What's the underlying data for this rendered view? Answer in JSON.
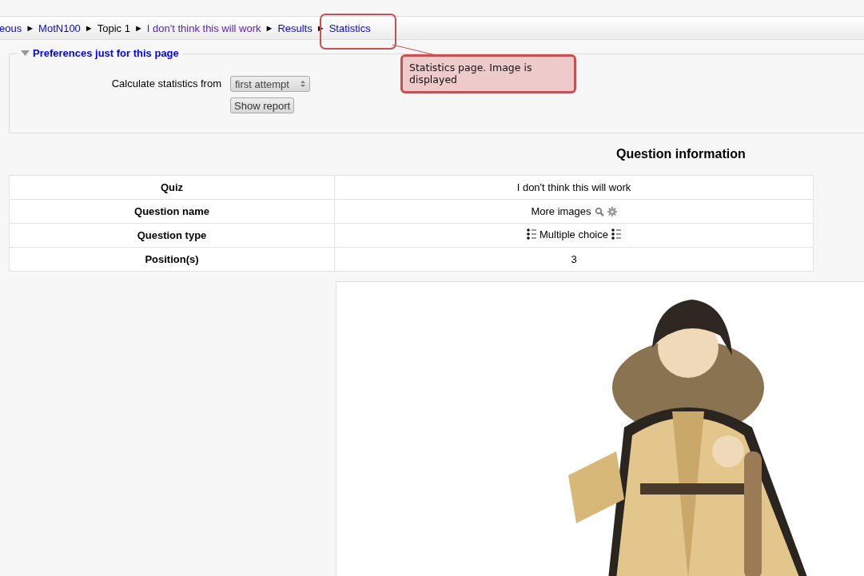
{
  "breadcrumb": [
    {
      "kind": "link",
      "text": "eous"
    },
    {
      "kind": "separator",
      "text": "►"
    },
    {
      "kind": "link",
      "text": "MotN100"
    },
    {
      "kind": "separator",
      "text": "►"
    },
    {
      "kind": "text",
      "text": "Topic 1"
    },
    {
      "kind": "separator",
      "text": "►"
    },
    {
      "kind": "visited",
      "text": "I don't think this will work"
    },
    {
      "kind": "separator",
      "text": "►"
    },
    {
      "kind": "link",
      "text": "Results"
    },
    {
      "kind": "separator",
      "text": "►"
    },
    {
      "kind": "link",
      "text": "Statistics"
    }
  ],
  "preferences": {
    "legend": "Preferences just for this page",
    "expanded": true,
    "field_label": "Calculate statistics from",
    "select_value": "first attempt",
    "button": "Show report"
  },
  "heading": "Question information",
  "table": {
    "rows": [
      {
        "kind": "plain",
        "label": "Quiz",
        "value": "I don't think this will work"
      },
      {
        "kind": "name",
        "label": "Question name",
        "value": "More images"
      },
      {
        "kind": "type",
        "label": "Question type",
        "value": "Multiple choice"
      },
      {
        "kind": "plain",
        "label": "Position(s)",
        "value": "3"
      }
    ]
  },
  "annotation": {
    "text": "Statistics page. Image is displayed"
  }
}
